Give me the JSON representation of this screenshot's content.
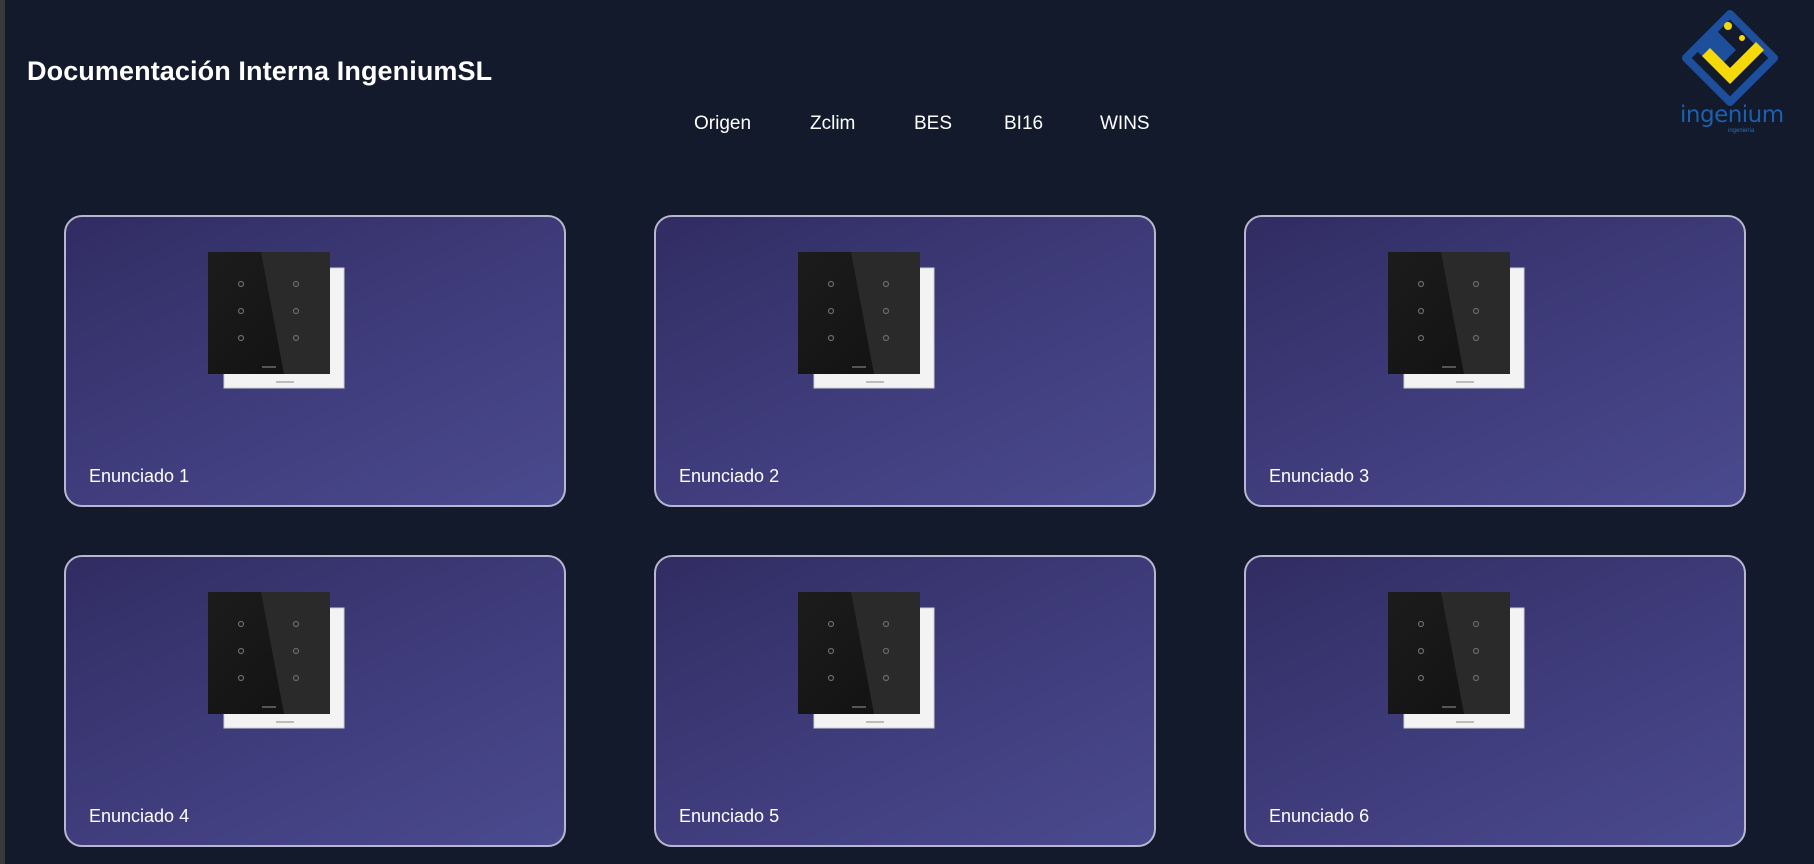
{
  "header": {
    "title": "Documentación Interna IngeniumSL",
    "logo_text": "ingenium",
    "logo_subtext": "ingeniería"
  },
  "nav": {
    "items": [
      {
        "label": "Origen"
      },
      {
        "label": "Zclim"
      },
      {
        "label": "BES"
      },
      {
        "label": "BI16"
      },
      {
        "label": "WINS"
      }
    ]
  },
  "cards": [
    {
      "label": "Enunciado 1",
      "icon": "switch-panel-image"
    },
    {
      "label": "Enunciado 2",
      "icon": "switch-panel-image"
    },
    {
      "label": "Enunciado 3",
      "icon": "switch-panel-image"
    },
    {
      "label": "Enunciado 4",
      "icon": "switch-panel-image"
    },
    {
      "label": "Enunciado 5",
      "icon": "switch-panel-image"
    },
    {
      "label": "Enunciado 6",
      "icon": "switch-panel-image"
    }
  ],
  "colors": {
    "background": "#121a2b",
    "card_gradient_start": "#312c62",
    "card_gradient_end": "#4a4a8f",
    "card_border": "#b9b7cf",
    "logo_blue": "#1d4f9c",
    "logo_yellow": "#f5d90a"
  }
}
